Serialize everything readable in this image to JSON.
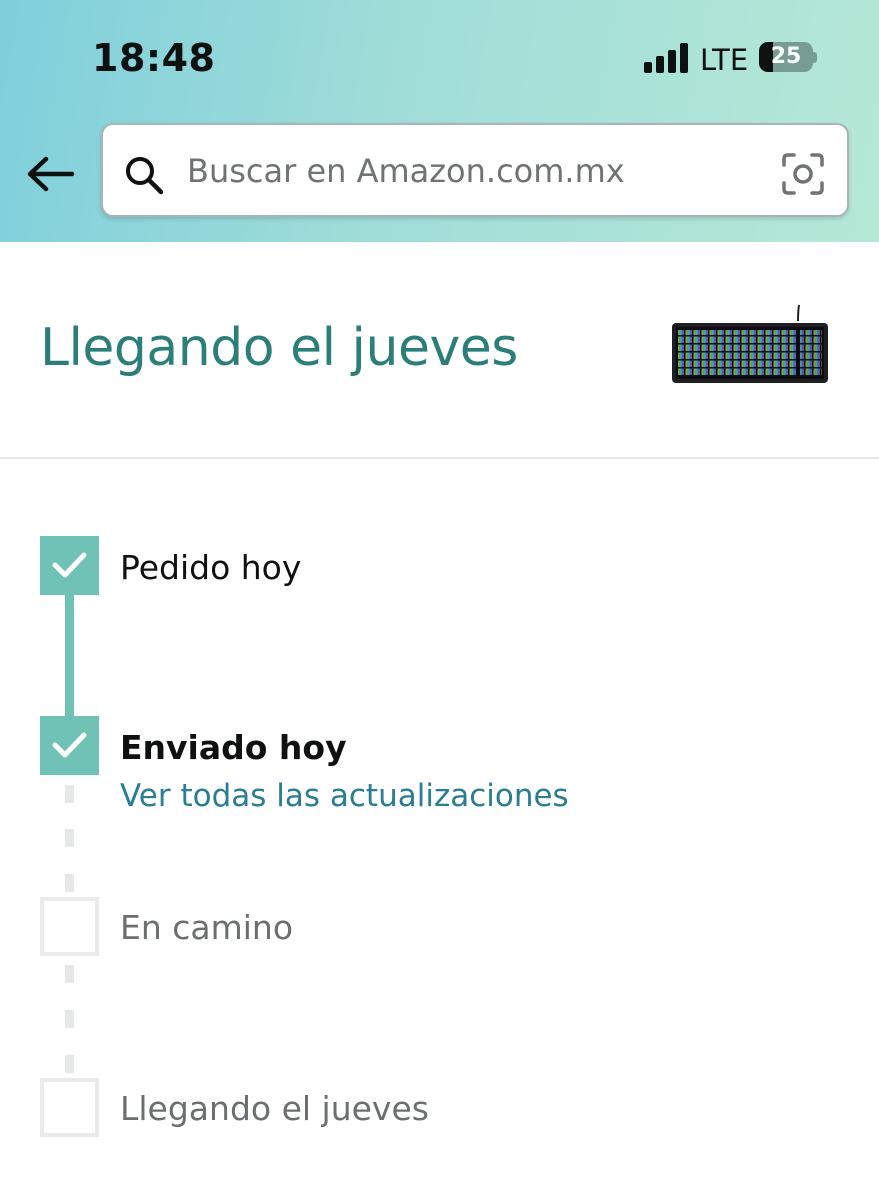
{
  "status_bar": {
    "time": "18:48",
    "network": "LTE",
    "battery": "25",
    "battery_fraction": 0.25
  },
  "search": {
    "placeholder": "Buscar en Amazon.com.mx"
  },
  "tracking": {
    "title": "Llegando el jueves",
    "steps": [
      {
        "label": "Pedido hoy",
        "state": "done"
      },
      {
        "label": "Enviado hoy",
        "state": "done",
        "link": "Ver todas las actualizaciones"
      },
      {
        "label": "En camino",
        "state": "pending"
      },
      {
        "label": "Llegando el jueves",
        "state": "pending"
      }
    ]
  },
  "colors": {
    "accent_teal": "#6fc2b5",
    "title_teal": "#2c7f78",
    "link_blue": "#2a7d92",
    "header_gradient_start": "#7fcfdc",
    "header_gradient_end": "#b6e8d6"
  },
  "icons": [
    "back-arrow-icon",
    "search-icon",
    "camera-scan-icon",
    "checkmark-icon",
    "signal-icon",
    "battery-icon"
  ]
}
